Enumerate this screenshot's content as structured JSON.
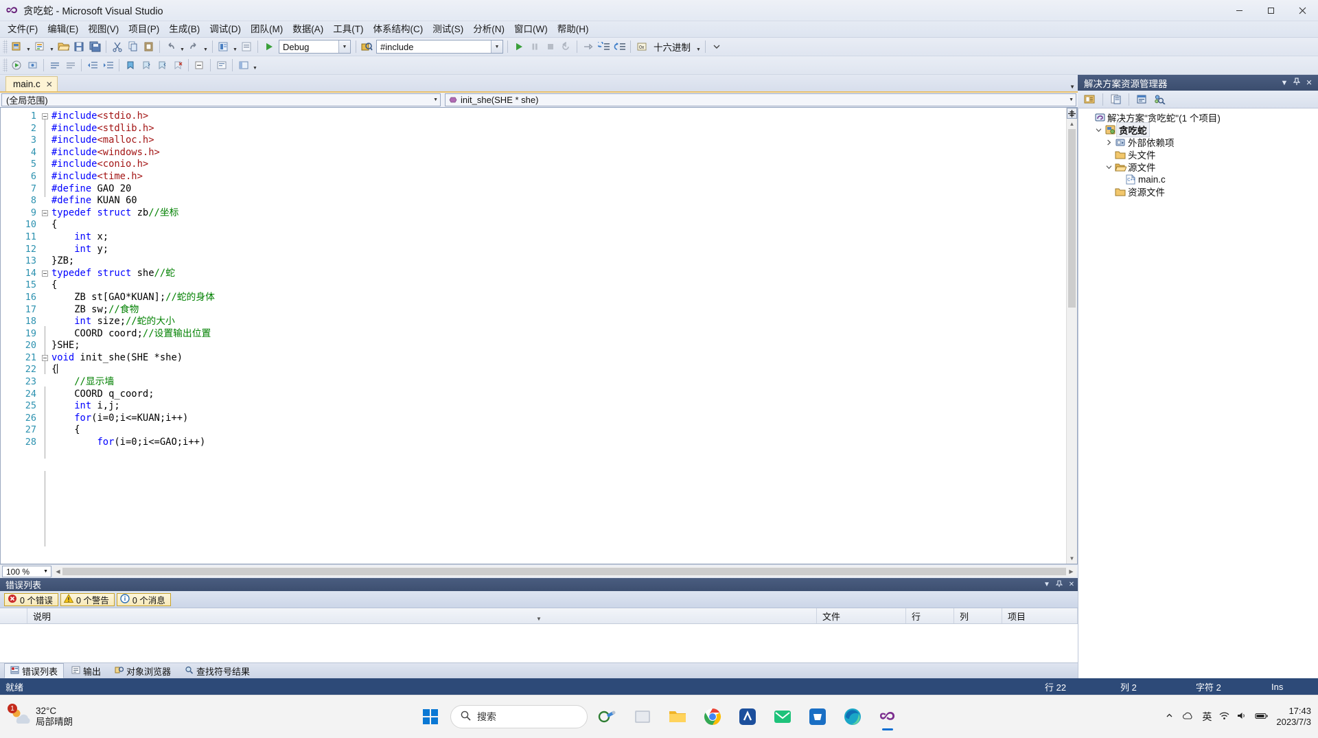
{
  "window": {
    "title": "贪吃蛇 - Microsoft Visual Studio",
    "logo_icon": "vs-infinity-icon",
    "minimize_label": "—",
    "maximize_label": "▢",
    "close_label": "✕"
  },
  "menubar": {
    "items": [
      {
        "label": "文件(F)"
      },
      {
        "label": "编辑(E)"
      },
      {
        "label": "视图(V)"
      },
      {
        "label": "项目(P)"
      },
      {
        "label": "生成(B)"
      },
      {
        "label": "调试(D)"
      },
      {
        "label": "团队(M)"
      },
      {
        "label": "数据(A)"
      },
      {
        "label": "工具(T)"
      },
      {
        "label": "体系结构(C)"
      },
      {
        "label": "测试(S)"
      },
      {
        "label": "分析(N)"
      },
      {
        "label": "窗口(W)"
      },
      {
        "label": "帮助(H)"
      }
    ]
  },
  "toolbar": {
    "config_value": "Debug",
    "find_value": "#include",
    "hex_label": "十六进制",
    "icons": [
      "new-project-icon",
      "new-item-icon",
      "open-file-icon",
      "save-icon",
      "save-all-icon",
      "cut-icon",
      "copy-icon",
      "paste-icon",
      "undo-icon",
      "redo-icon",
      "navigate-backward-icon",
      "navigate-forward-icon",
      "start-debug-icon",
      "find-in-files-icon",
      "run-icon",
      "pause-icon",
      "stop-icon",
      "restart-icon",
      "step-over-icon",
      "step-into-icon",
      "step-out-icon",
      "hex-display-icon"
    ]
  },
  "tabs": {
    "open_documents": [
      {
        "label": "main.c",
        "close_label": "✕",
        "active": true
      }
    ],
    "dropdown_icon": "chevron-down-icon"
  },
  "navbar": {
    "scope_value": "(全局范围)",
    "member_value": "init_she(SHE * she)",
    "member_icon": "method-icon"
  },
  "editor": {
    "zoom_level": "100 %",
    "lines": [
      {
        "n": 1,
        "fold": "minus",
        "text": "#include<stdio.h>",
        "type": "include",
        "inc": "stdio.h"
      },
      {
        "n": 2,
        "fold": "",
        "text": "#include<stdlib.h>",
        "type": "include",
        "inc": "stdlib.h"
      },
      {
        "n": 3,
        "fold": "",
        "text": "#include<malloc.h>",
        "type": "include",
        "inc": "malloc.h"
      },
      {
        "n": 4,
        "fold": "",
        "text": "#include<windows.h>",
        "type": "include",
        "inc": "windows.h"
      },
      {
        "n": 5,
        "fold": "",
        "text": "#include<conio.h>",
        "type": "include",
        "inc": "conio.h"
      },
      {
        "n": 6,
        "fold": "",
        "text": "#include<time.h>",
        "type": "include",
        "inc": "time.h"
      },
      {
        "n": 7,
        "fold": "",
        "text": "#define GAO 20",
        "type": "define"
      },
      {
        "n": 8,
        "fold": "",
        "text": "#define KUAN 60",
        "type": "define"
      },
      {
        "n": 9,
        "fold": "minus",
        "text": "typedef struct zb//坐标",
        "type": "typedef_zb"
      },
      {
        "n": 10,
        "fold": "",
        "text": "{",
        "type": "plain"
      },
      {
        "n": 11,
        "fold": "",
        "text": "    int x;",
        "type": "int_decl"
      },
      {
        "n": 12,
        "fold": "",
        "text": "    int y;",
        "type": "int_decl"
      },
      {
        "n": 13,
        "fold": "",
        "text": "}ZB;",
        "type": "plain"
      },
      {
        "n": 14,
        "fold": "minus",
        "text": "typedef struct she//蛇",
        "type": "typedef_she"
      },
      {
        "n": 15,
        "fold": "",
        "text": "{",
        "type": "plain"
      },
      {
        "n": 16,
        "fold": "",
        "text": "    ZB st[GAO*KUAN];//蛇的身体",
        "type": "cmt_tail"
      },
      {
        "n": 17,
        "fold": "",
        "text": "    ZB sw;//食物",
        "type": "cmt_tail"
      },
      {
        "n": 18,
        "fold": "",
        "text": "    int size;//蛇的大小",
        "type": "int_cmt"
      },
      {
        "n": 19,
        "fold": "",
        "text": "    COORD coord;//设置输出位置",
        "type": "cmt_tail"
      },
      {
        "n": 20,
        "fold": "",
        "text": "}SHE;",
        "type": "plain"
      },
      {
        "n": 21,
        "fold": "minus",
        "text": "void init_she(SHE *she)",
        "type": "func_def"
      },
      {
        "n": 22,
        "fold": "",
        "text": "{",
        "type": "caret_line"
      },
      {
        "n": 23,
        "fold": "",
        "text": "    //显示墙",
        "type": "comment_only"
      },
      {
        "n": 24,
        "fold": "",
        "text": "    COORD q_coord;",
        "type": "plain"
      },
      {
        "n": 25,
        "fold": "",
        "text": "    int i,j;",
        "type": "int_decl"
      },
      {
        "n": 26,
        "fold": "",
        "text": "    for(i=0;i<=KUAN;i++)",
        "type": "for_line"
      },
      {
        "n": 27,
        "fold": "",
        "text": "    {",
        "type": "plain"
      },
      {
        "n": 28,
        "fold": "",
        "text": "        for(i=0;i<=GAO;i++)",
        "type": "for_line"
      }
    ]
  },
  "error_list": {
    "title": "错误列表",
    "chips": [
      {
        "icon": "error-icon",
        "label": "0 个错误"
      },
      {
        "icon": "warning-icon",
        "label": "0 个警告"
      },
      {
        "icon": "info-icon",
        "label": "0 个消息"
      }
    ],
    "columns": [
      "说明",
      "文件",
      "行",
      "列",
      "项目"
    ],
    "rows": [],
    "panel_buttons": [
      "chevron-down-icon",
      "pin-icon",
      "close-icon"
    ]
  },
  "bottom_tabs": [
    {
      "label": "错误列表",
      "icon": "error-list-icon",
      "active": true
    },
    {
      "label": "输出",
      "icon": "output-icon",
      "active": false
    },
    {
      "label": "对象浏览器",
      "icon": "object-browser-icon",
      "active": false
    },
    {
      "label": "查找符号结果",
      "icon": "find-symbol-icon",
      "active": false
    }
  ],
  "solution_explorer": {
    "title": "解决方案资源管理器",
    "panel_buttons": [
      "chevron-down-icon",
      "pin-icon",
      "close-icon"
    ],
    "toolbar_icons": [
      "properties-icon",
      "show-all-files-icon",
      "view-code-icon",
      "search-class-icon"
    ],
    "tree": [
      {
        "indent": 0,
        "twisty": "",
        "icon": "solution-icon",
        "label": "解决方案\"贪吃蛇\"(1 个项目)",
        "selected": false
      },
      {
        "indent": 1,
        "twisty": "open",
        "icon": "project-icon",
        "label": "贪吃蛇",
        "selected": true
      },
      {
        "indent": 2,
        "twisty": "closed",
        "icon": "references-icon",
        "label": "外部依赖项",
        "selected": false
      },
      {
        "indent": 2,
        "twisty": "",
        "icon": "folder-icon",
        "label": "头文件",
        "selected": false
      },
      {
        "indent": 2,
        "twisty": "open",
        "icon": "folder-open-icon",
        "label": "源文件",
        "selected": false
      },
      {
        "indent": 3,
        "twisty": "",
        "icon": "c-file-icon",
        "label": "main.c",
        "selected": false
      },
      {
        "indent": 2,
        "twisty": "",
        "icon": "folder-icon",
        "label": "资源文件",
        "selected": false
      }
    ]
  },
  "status_bar": {
    "state": "就绪",
    "line": "行 22",
    "column": "列 2",
    "character": "字符 2",
    "insert_mode": "Ins"
  },
  "taskbar": {
    "weather": {
      "temperature": "32°C",
      "condition": "局部晴朗",
      "badge": "1",
      "icon": "cloud-sun-icon"
    },
    "start_label": "start-icon",
    "search_placeholder": "搜索",
    "search_icon": "search-icon",
    "apps": [
      {
        "icon": "task-view-icon",
        "name": "task-view",
        "active": false
      },
      {
        "icon": "file-explorer-icon",
        "name": "file-explorer",
        "active": false
      },
      {
        "icon": "chrome-icon",
        "name": "chrome",
        "active": false
      },
      {
        "icon": "app-blue-icon",
        "name": "app-blue",
        "active": false
      },
      {
        "icon": "mail-icon",
        "name": "mail",
        "active": false
      },
      {
        "icon": "store-icon",
        "name": "store",
        "active": false
      },
      {
        "icon": "edge-icon",
        "name": "edge",
        "active": false
      },
      {
        "icon": "visual-studio-icon",
        "name": "visual-studio",
        "active": true
      }
    ],
    "tray": {
      "chevron": "show-hidden-icons",
      "cloud": "onedrive-icon",
      "ime": "英",
      "network": "network-icon",
      "volume": "volume-icon",
      "battery": "battery-icon",
      "time": "17:43",
      "date": "2023/7/3"
    }
  },
  "colors": {
    "keyword": "#0000ff",
    "string": "#a31515",
    "comment": "#008000",
    "linenum": "#2b91af",
    "accent": "#2d4a78",
    "tab_underline": "#e7bf6a"
  }
}
